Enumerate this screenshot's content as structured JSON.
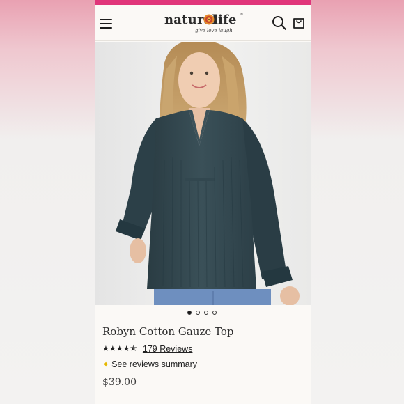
{
  "colors": {
    "top_bar": "#e0357a",
    "page_background": "#fbf9f6",
    "text": "#2a2a2a",
    "sparkle": "#e5b800",
    "logo_flower": "#e58a2c"
  },
  "header": {
    "menu_icon": "hamburger-menu-icon",
    "logo_text_left": "natural",
    "logo_text_right": "life",
    "logo_registered": "®",
    "logo_tagline": "give love laugh",
    "search_icon": "search-icon",
    "cart_icon": "shopping-bag-icon"
  },
  "gallery": {
    "image_alt": "Model wearing Robyn Cotton Gauze Top in dark teal",
    "slide_count": 4,
    "active_slide": 1
  },
  "product": {
    "title": "Robyn Cotton Gauze Top",
    "rating_stars": "★★★★⯪",
    "rating_value": 4.5,
    "reviews_label": "179 Reviews",
    "summary_icon": "sparkle-icon",
    "summary_glyph": "✦",
    "summary_label": "See reviews summary",
    "price": "$39.00"
  }
}
